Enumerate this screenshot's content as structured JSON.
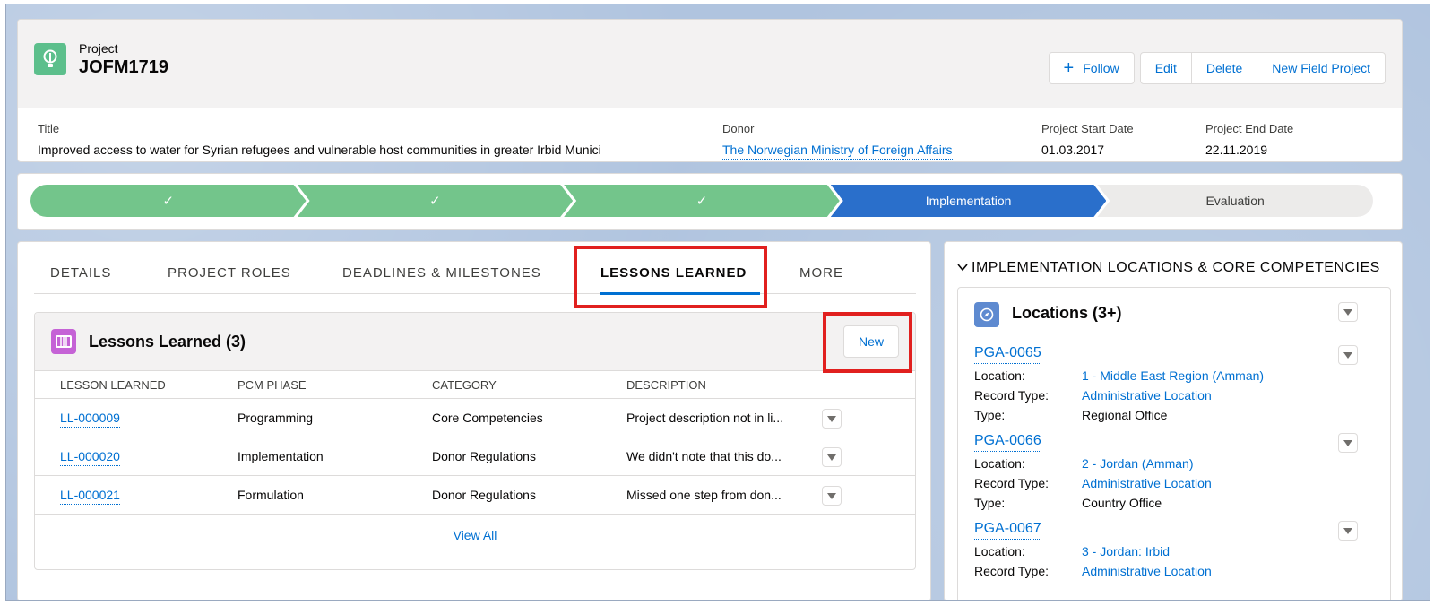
{
  "header": {
    "object_type": "Project",
    "record_name": "JOFM1719",
    "icon": "lightbulb-icon",
    "buttons": {
      "follow": "Follow",
      "edit": "Edit",
      "delete": "Delete",
      "new_field_project": "New Field Project"
    },
    "fields": {
      "title_label": "Title",
      "title_value": "Improved access to water for Syrian refugees and vulnerable host communities in greater Irbid Munici",
      "donor_label": "Donor",
      "donor_value": "The Norwegian Ministry of Foreign Affairs",
      "start_label": "Project Start Date",
      "start_value": "01.03.2017",
      "end_label": "Project End Date",
      "end_value": "22.11.2019"
    }
  },
  "path": {
    "stages": [
      {
        "label": "✓",
        "state": "done"
      },
      {
        "label": "✓",
        "state": "done"
      },
      {
        "label": "✓",
        "state": "done"
      },
      {
        "label": "Implementation",
        "state": "current"
      },
      {
        "label": "Evaluation",
        "state": "todo"
      }
    ],
    "colors": {
      "done": "#73c58b",
      "current": "#2a6fcb",
      "todo": "#ecebea"
    }
  },
  "tabs": {
    "details": "DETAILS",
    "project_roles": "PROJECT ROLES",
    "deadlines": "DEADLINES & MILESTONES",
    "lessons": "LESSONS LEARNED",
    "more": "MORE"
  },
  "lessons": {
    "title": "Lessons Learned (3)",
    "new_label": "New",
    "columns": [
      "LESSON LEARNED",
      "PCM PHASE",
      "CATEGORY",
      "DESCRIPTION"
    ],
    "rows": [
      {
        "id": "LL-000009",
        "phase": "Programming",
        "category": "Core Competencies",
        "description": "Project description not in li..."
      },
      {
        "id": "LL-000020",
        "phase": "Implementation",
        "category": "Donor Regulations",
        "description": "We didn't note that this do..."
      },
      {
        "id": "LL-000021",
        "phase": "Formulation",
        "category": "Donor Regulations",
        "description": "Missed one step from don..."
      }
    ],
    "view_all": "View All"
  },
  "right": {
    "section_title": "IMPLEMENTATION LOCATIONS & CORE COMPETENCIES",
    "locations_title": "Locations (3+)",
    "labels": {
      "location": "Location:",
      "record_type": "Record Type:",
      "type": "Type:"
    },
    "items": [
      {
        "id": "PGA-0065",
        "location": "1 - Middle East Region (Amman)",
        "record_type": "Administrative Location",
        "type": "Regional Office"
      },
      {
        "id": "PGA-0066",
        "location": "2 - Jordan (Amman)",
        "record_type": "Administrative Location",
        "type": "Country Office"
      },
      {
        "id": "PGA-0067",
        "location": "3 - Jordan: Irbid",
        "record_type": "Administrative Location",
        "type": ""
      }
    ]
  },
  "colors": {
    "accent": "#0070d2",
    "highlight": "#e1201f"
  }
}
